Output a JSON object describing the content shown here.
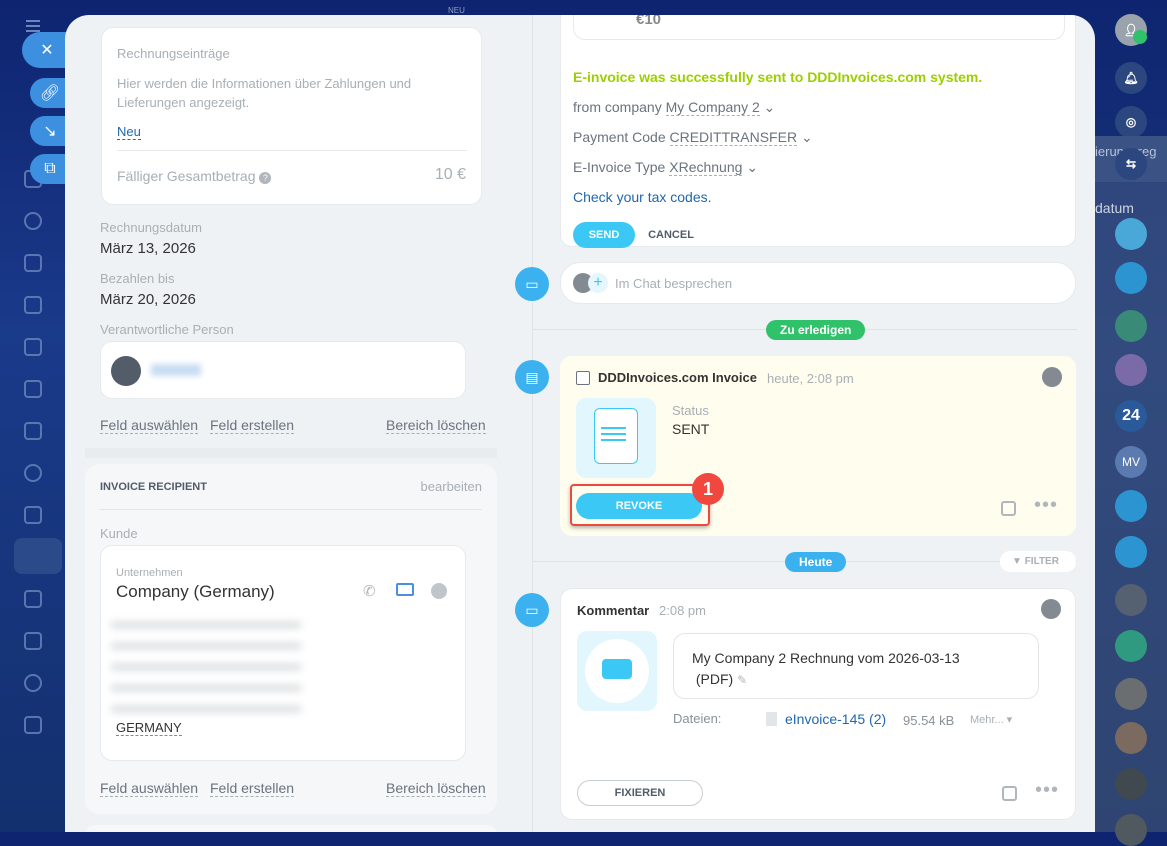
{
  "left_panel": {
    "entries": {
      "title": "Rechnungseinträge",
      "info": "Hier werden die Informationen über Zahlungen und Lieferungen angezeigt.",
      "new_link": "Neu",
      "total_label": "Fälliger Gesamtbetrag",
      "total_value": "10 €"
    },
    "invoice_date": {
      "label": "Rechnungsdatum",
      "value": "März 13, 2026"
    },
    "due_date": {
      "label": "Bezahlen bis",
      "value": "März 20, 2026"
    },
    "responsible": {
      "label": "Verantwortliche Person"
    },
    "actions": {
      "select": "Feld auswählen",
      "create": "Feld erstellen",
      "delete": "Bereich löschen"
    },
    "recipient": {
      "title": "INVOICE RECIPIENT",
      "edit": "bearbeiten",
      "customer_label": "Kunde",
      "company_type": "Unternehmen",
      "company_name": "Company (Germany)",
      "country": "GERMANY"
    }
  },
  "einvoice": {
    "amount": "€10",
    "success": "E-invoice was successfully sent to DDDInvoices.com system.",
    "from_label": "from company",
    "from_value": "My Company 2",
    "payment_label": "Payment Code",
    "payment_value": "CREDITTRANSFER",
    "type_label": "E-Invoice Type",
    "type_value": "XRechnung",
    "tax_link": "Check your tax codes.",
    "send": "SEND",
    "cancel": "CANCEL"
  },
  "chat": {
    "placeholder": "Im Chat besprechen"
  },
  "todo_pill": "Zu erledigen",
  "task": {
    "title": "DDDInvoices.com Invoice",
    "time": "heute, 2:08 pm",
    "status_label": "Status",
    "status_value": "SENT",
    "revoke": "REVOKE",
    "badge": "1"
  },
  "today_pill": "Heute",
  "filter": "FILTER",
  "comment": {
    "title": "Kommentar",
    "time": "2:08 pm",
    "text": "My Company 2 Rechnung vom 2026-03-13",
    "text2": "(PDF)",
    "files_label": "Dateien:",
    "file_name": "eInvoice-145 (2)",
    "file_size": "95.54 kB",
    "more": "Mehr...",
    "pin": "FIXIEREN"
  },
  "right_sidebar": {
    "partial_text1": "ierungsreg",
    "partial_text2": "datum",
    "avatars": [
      "24",
      "MV"
    ]
  },
  "top": {
    "neu": "NEU"
  },
  "colors": {
    "accent": "#3bc8f5",
    "success": "#9dcf00",
    "link": "#2067b0",
    "badge": "#f0483e"
  }
}
